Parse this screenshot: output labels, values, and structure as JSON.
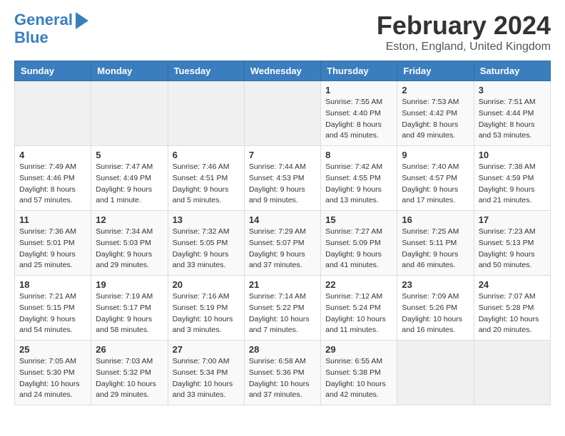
{
  "header": {
    "logo_line1": "General",
    "logo_line2": "Blue",
    "title": "February 2024",
    "location": "Eston, England, United Kingdom"
  },
  "weekdays": [
    "Sunday",
    "Monday",
    "Tuesday",
    "Wednesday",
    "Thursday",
    "Friday",
    "Saturday"
  ],
  "weeks": [
    [
      {
        "day": "",
        "info": ""
      },
      {
        "day": "",
        "info": ""
      },
      {
        "day": "",
        "info": ""
      },
      {
        "day": "",
        "info": ""
      },
      {
        "day": "1",
        "info": "Sunrise: 7:55 AM\nSunset: 4:40 PM\nDaylight: 8 hours\nand 45 minutes."
      },
      {
        "day": "2",
        "info": "Sunrise: 7:53 AM\nSunset: 4:42 PM\nDaylight: 8 hours\nand 49 minutes."
      },
      {
        "day": "3",
        "info": "Sunrise: 7:51 AM\nSunset: 4:44 PM\nDaylight: 8 hours\nand 53 minutes."
      }
    ],
    [
      {
        "day": "4",
        "info": "Sunrise: 7:49 AM\nSunset: 4:46 PM\nDaylight: 8 hours\nand 57 minutes."
      },
      {
        "day": "5",
        "info": "Sunrise: 7:47 AM\nSunset: 4:49 PM\nDaylight: 9 hours\nand 1 minute."
      },
      {
        "day": "6",
        "info": "Sunrise: 7:46 AM\nSunset: 4:51 PM\nDaylight: 9 hours\nand 5 minutes."
      },
      {
        "day": "7",
        "info": "Sunrise: 7:44 AM\nSunset: 4:53 PM\nDaylight: 9 hours\nand 9 minutes."
      },
      {
        "day": "8",
        "info": "Sunrise: 7:42 AM\nSunset: 4:55 PM\nDaylight: 9 hours\nand 13 minutes."
      },
      {
        "day": "9",
        "info": "Sunrise: 7:40 AM\nSunset: 4:57 PM\nDaylight: 9 hours\nand 17 minutes."
      },
      {
        "day": "10",
        "info": "Sunrise: 7:38 AM\nSunset: 4:59 PM\nDaylight: 9 hours\nand 21 minutes."
      }
    ],
    [
      {
        "day": "11",
        "info": "Sunrise: 7:36 AM\nSunset: 5:01 PM\nDaylight: 9 hours\nand 25 minutes."
      },
      {
        "day": "12",
        "info": "Sunrise: 7:34 AM\nSunset: 5:03 PM\nDaylight: 9 hours\nand 29 minutes."
      },
      {
        "day": "13",
        "info": "Sunrise: 7:32 AM\nSunset: 5:05 PM\nDaylight: 9 hours\nand 33 minutes."
      },
      {
        "day": "14",
        "info": "Sunrise: 7:29 AM\nSunset: 5:07 PM\nDaylight: 9 hours\nand 37 minutes."
      },
      {
        "day": "15",
        "info": "Sunrise: 7:27 AM\nSunset: 5:09 PM\nDaylight: 9 hours\nand 41 minutes."
      },
      {
        "day": "16",
        "info": "Sunrise: 7:25 AM\nSunset: 5:11 PM\nDaylight: 9 hours\nand 46 minutes."
      },
      {
        "day": "17",
        "info": "Sunrise: 7:23 AM\nSunset: 5:13 PM\nDaylight: 9 hours\nand 50 minutes."
      }
    ],
    [
      {
        "day": "18",
        "info": "Sunrise: 7:21 AM\nSunset: 5:15 PM\nDaylight: 9 hours\nand 54 minutes."
      },
      {
        "day": "19",
        "info": "Sunrise: 7:19 AM\nSunset: 5:17 PM\nDaylight: 9 hours\nand 58 minutes."
      },
      {
        "day": "20",
        "info": "Sunrise: 7:16 AM\nSunset: 5:19 PM\nDaylight: 10 hours\nand 3 minutes."
      },
      {
        "day": "21",
        "info": "Sunrise: 7:14 AM\nSunset: 5:22 PM\nDaylight: 10 hours\nand 7 minutes."
      },
      {
        "day": "22",
        "info": "Sunrise: 7:12 AM\nSunset: 5:24 PM\nDaylight: 10 hours\nand 11 minutes."
      },
      {
        "day": "23",
        "info": "Sunrise: 7:09 AM\nSunset: 5:26 PM\nDaylight: 10 hours\nand 16 minutes."
      },
      {
        "day": "24",
        "info": "Sunrise: 7:07 AM\nSunset: 5:28 PM\nDaylight: 10 hours\nand 20 minutes."
      }
    ],
    [
      {
        "day": "25",
        "info": "Sunrise: 7:05 AM\nSunset: 5:30 PM\nDaylight: 10 hours\nand 24 minutes."
      },
      {
        "day": "26",
        "info": "Sunrise: 7:03 AM\nSunset: 5:32 PM\nDaylight: 10 hours\nand 29 minutes."
      },
      {
        "day": "27",
        "info": "Sunrise: 7:00 AM\nSunset: 5:34 PM\nDaylight: 10 hours\nand 33 minutes."
      },
      {
        "day": "28",
        "info": "Sunrise: 6:58 AM\nSunset: 5:36 PM\nDaylight: 10 hours\nand 37 minutes."
      },
      {
        "day": "29",
        "info": "Sunrise: 6:55 AM\nSunset: 5:38 PM\nDaylight: 10 hours\nand 42 minutes."
      },
      {
        "day": "",
        "info": ""
      },
      {
        "day": "",
        "info": ""
      }
    ]
  ]
}
